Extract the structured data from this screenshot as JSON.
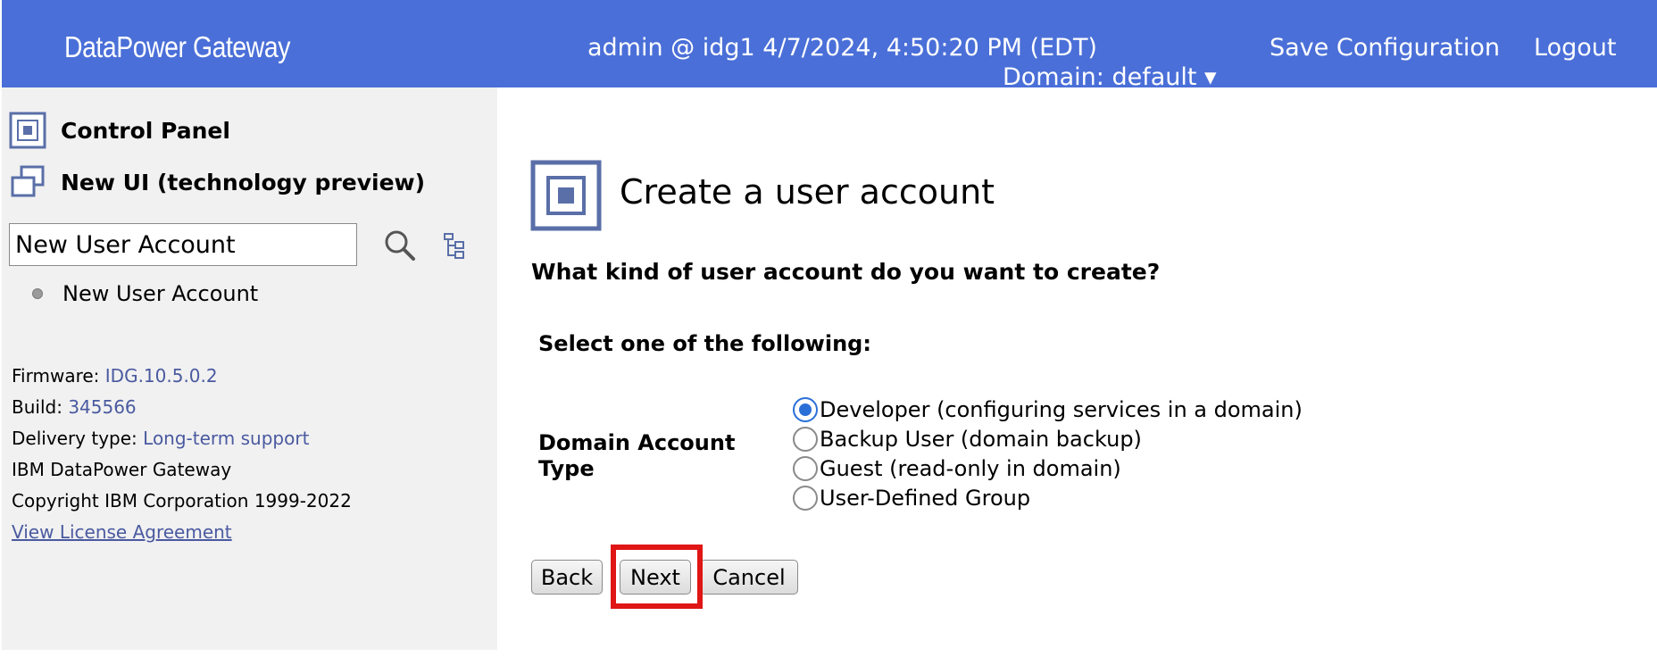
{
  "header": {
    "brand": "DataPower Gateway",
    "session": "admin @ idg1 4/7/2024, 4:50:20 PM (EDT)",
    "domain": "Domain: default ▾",
    "save_configuration": "Save Configuration",
    "logout": "Logout",
    "color": "#4a6fd8"
  },
  "sidebar": {
    "control_panel": "Control Panel",
    "new_ui": "New UI (technology preview)",
    "search": {
      "value": "New User Account"
    },
    "results": [
      {
        "label": "New User Account"
      }
    ],
    "info": {
      "firmware_label": "Firmware:",
      "firmware_value": "IDG.10.5.0.2",
      "build_label": "Build:",
      "build_value": "345566",
      "delivery_label": "Delivery type:",
      "delivery_value": "Long-term support",
      "product": "IBM DataPower Gateway",
      "copyright": "Copyright IBM Corporation 1999-2022",
      "license_link": "View License Agreement"
    }
  },
  "main": {
    "title": "Create a user account",
    "question": "What kind of user account do you want to create?",
    "select_prompt": "Select one of the following:",
    "field_label": "Domain Account Type",
    "options": [
      {
        "label": "Developer (configuring services in a domain)",
        "selected": true
      },
      {
        "label": "Backup User (domain backup)",
        "selected": false
      },
      {
        "label": "Guest (read-only in domain)",
        "selected": false
      },
      {
        "label": "User-Defined Group",
        "selected": false
      }
    ],
    "buttons": {
      "back": "Back",
      "next": "Next",
      "cancel": "Cancel"
    },
    "highlight_color": "#e01515"
  }
}
